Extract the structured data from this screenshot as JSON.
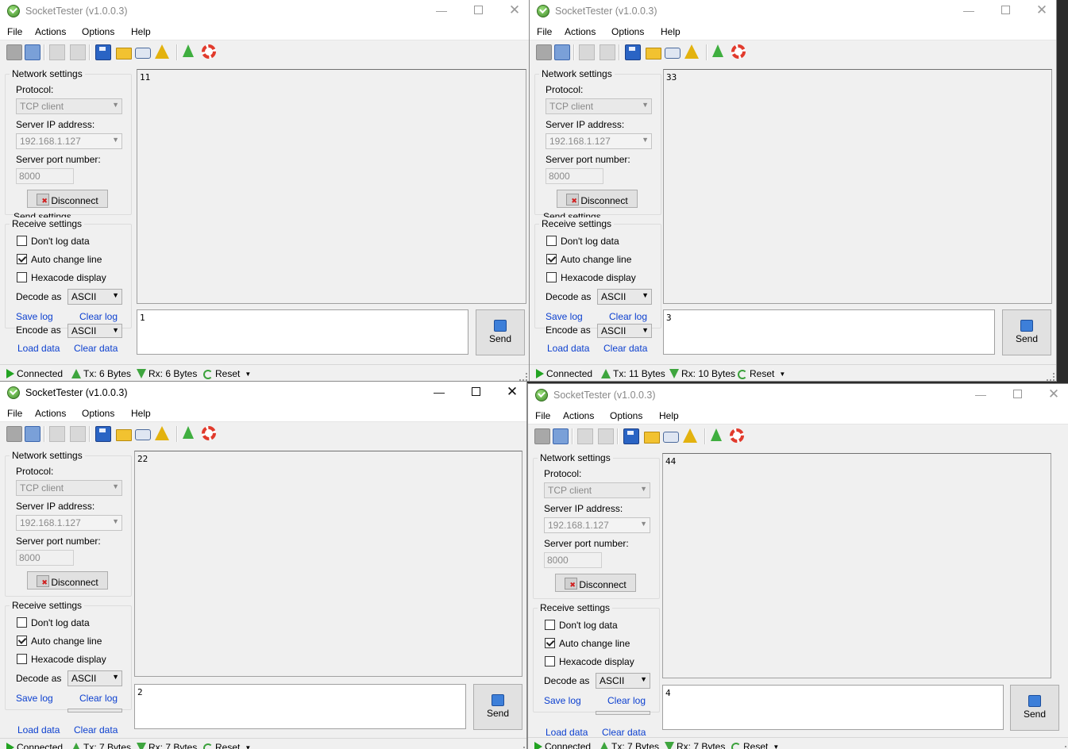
{
  "windows": [
    {
      "title": "SocketTester (v1.0.0.3)",
      "menu": [
        "File",
        "Actions",
        "Options",
        "Help"
      ],
      "network_legend": "Network settings",
      "protocol_label": "Protocol:",
      "protocol_value": "TCP client",
      "ip_label": "Server IP address:",
      "ip_value": "192.168.1.127",
      "port_label": "Server port number:",
      "port_value": "8000",
      "disconnect_label": "Disconnect",
      "send_legend": "Send settings",
      "receive_legend": "Receive settings",
      "chk_dont_log": "Don't log data",
      "chk_auto_change": "Auto change line",
      "chk_hexacode": "Hexacode display",
      "decode_label": "Decode as",
      "decode_value": "ASCII",
      "save_log": "Save log",
      "clear_log": "Clear log",
      "encode_label": "Encode as",
      "encode_value": "ASCII",
      "load_data": "Load data",
      "clear_data": "Clear data",
      "log_text": "11",
      "input_text": "1",
      "send_label": "Send",
      "status_connected": "Connected",
      "status_tx": "Tx: 6 Bytes",
      "status_rx": "Rx: 6 Bytes",
      "status_reset": "Reset",
      "dont_log_checked": false,
      "auto_change_checked": true,
      "hexacode_checked": false
    },
    {
      "title": "SocketTester (v1.0.0.3)",
      "menu": [
        "File",
        "Actions",
        "Options",
        "Help"
      ],
      "network_legend": "Network settings",
      "protocol_label": "Protocol:",
      "protocol_value": "TCP client",
      "ip_label": "Server IP address:",
      "ip_value": "192.168.1.127",
      "port_label": "Server port number:",
      "port_value": "8000",
      "disconnect_label": "Disconnect",
      "send_legend": "Send settings",
      "receive_legend": "Receive settings",
      "chk_dont_log": "Don't log data",
      "chk_auto_change": "Auto change line",
      "chk_hexacode": "Hexacode display",
      "decode_label": "Decode as",
      "decode_value": "ASCII",
      "save_log": "Save log",
      "clear_log": "Clear log",
      "encode_label": "Encode as",
      "encode_value": "ASCII",
      "load_data": "Load data",
      "clear_data": "Clear data",
      "log_text": "33",
      "input_text": "3",
      "send_label": "Send",
      "status_connected": "Connected",
      "status_tx": "Tx: 11 Bytes",
      "status_rx": "Rx: 10 Bytes",
      "status_reset": "Reset",
      "dont_log_checked": false,
      "auto_change_checked": true,
      "hexacode_checked": false
    },
    {
      "title": "SocketTester (v1.0.0.3)",
      "menu": [
        "File",
        "Actions",
        "Options",
        "Help"
      ],
      "network_legend": "Network settings",
      "protocol_label": "Protocol:",
      "protocol_value": "TCP client",
      "ip_label": "Server IP address:",
      "ip_value": "192.168.1.127",
      "port_label": "Server port number:",
      "port_value": "8000",
      "disconnect_label": "Disconnect",
      "send_legend": "",
      "receive_legend": "Receive settings",
      "chk_dont_log": "Don't log data",
      "chk_auto_change": "Auto change line",
      "chk_hexacode": "Hexacode display",
      "decode_label": "Decode as",
      "decode_value": "ASCII",
      "save_log": "Save log",
      "clear_log": "Clear log",
      "encode_label": "",
      "encode_value": "",
      "load_data": "Load data",
      "clear_data": "Clear data",
      "log_text": "22",
      "input_text": "2",
      "send_label": "Send",
      "status_connected": "Connected",
      "status_tx": "Tx: 7 Bytes",
      "status_rx": "Rx: 7 Bytes",
      "status_reset": "Reset",
      "dont_log_checked": false,
      "auto_change_checked": true,
      "hexacode_checked": false
    },
    {
      "title": "SocketTester (v1.0.0.3)",
      "menu": [
        "File",
        "Actions",
        "Options",
        "Help"
      ],
      "network_legend": "Network settings",
      "protocol_label": "Protocol:",
      "protocol_value": "TCP client",
      "ip_label": "Server IP address:",
      "ip_value": "192.168.1.127",
      "port_label": "Server port number:",
      "port_value": "8000",
      "disconnect_label": "Disconnect",
      "send_legend": "",
      "receive_legend": "Receive settings",
      "chk_dont_log": "Don't log data",
      "chk_auto_change": "Auto change line",
      "chk_hexacode": "Hexacode display",
      "decode_label": "Decode as",
      "decode_value": "ASCII",
      "save_log": "Save log",
      "clear_log": "Clear log",
      "encode_label": "",
      "encode_value": "",
      "load_data": "Load data",
      "clear_data": "Clear data",
      "log_text": "44",
      "input_text": "4",
      "send_label": "Send",
      "status_connected": "Connected",
      "status_tx": "Tx: 7 Bytes",
      "status_rx": "Rx: 7 Bytes",
      "status_reset": "Reset",
      "dont_log_checked": false,
      "auto_change_checked": true,
      "hexacode_checked": false
    }
  ],
  "toolbar_icons": [
    "connect-icon",
    "connect-settings-icon",
    "send-icon",
    "send-file-icon",
    "save-icon",
    "open-folder-icon",
    "print-icon",
    "clear-broom-icon",
    "test-flask-icon",
    "help-lifebuoy-icon"
  ]
}
